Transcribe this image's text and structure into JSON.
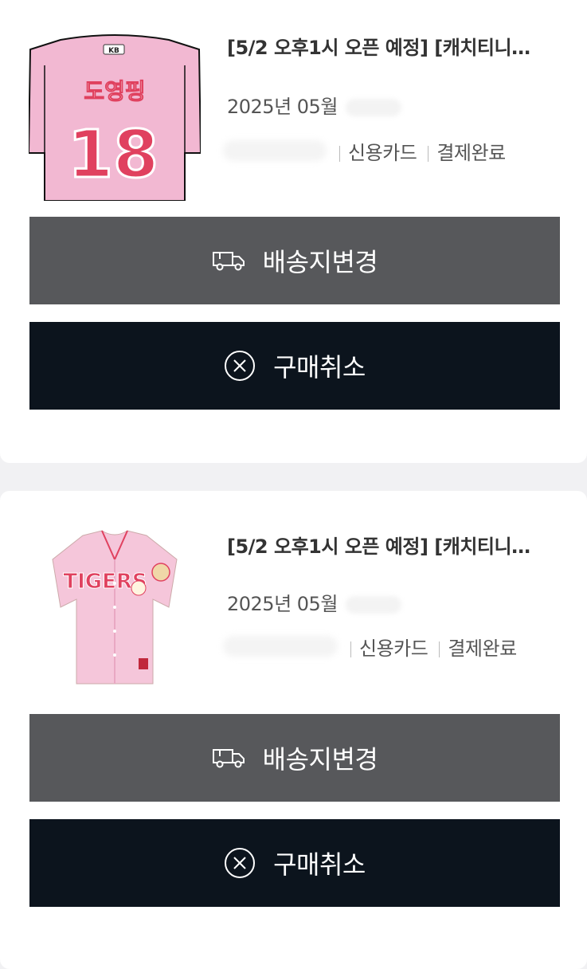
{
  "orders": [
    {
      "title": "[5/2 오후1시 오픈 예정] [캐치티니…",
      "date": "2025년 05월",
      "payment_method": "신용카드",
      "payment_status": "결제완료",
      "thumb_name": "도영핑",
      "thumb_number": "18",
      "ship_label": "배송지변경",
      "cancel_label": "구매취소"
    },
    {
      "title": "[5/2 오후1시 오픈 예정] [캐치티니…",
      "date": "2025년 05월",
      "payment_method": "신용카드",
      "payment_status": "결제완료",
      "thumb_name": "TIGERS",
      "ship_label": "배송지변경",
      "cancel_label": "구매취소"
    }
  ],
  "icons": {
    "ship": "truck-icon",
    "cancel": "circle-x-icon"
  },
  "colors": {
    "ship_button_bg": "#57585b",
    "cancel_button_bg": "#0c141d",
    "jersey_pink": "#f2b8d2",
    "jersey_red": "#e0415f"
  }
}
